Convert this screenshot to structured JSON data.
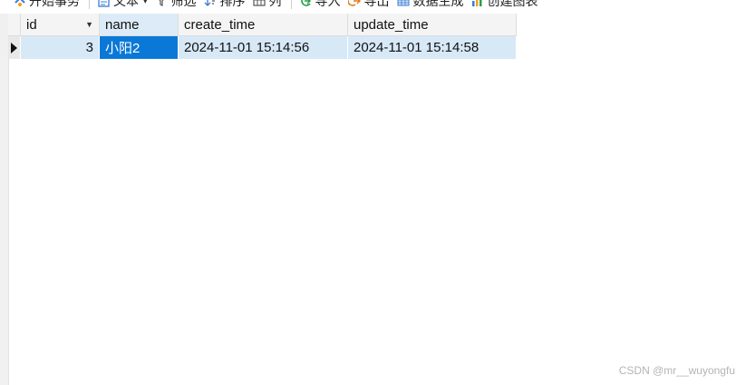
{
  "toolbar": {
    "items": [
      {
        "label": "开始事务",
        "icon": "transaction-icon"
      },
      {
        "label": "文本",
        "icon": "text-icon",
        "dropdown": true
      },
      {
        "label": "筛选",
        "icon": "filter-icon"
      },
      {
        "label": "排序",
        "icon": "sort-icon"
      },
      {
        "label": "列",
        "icon": "columns-icon"
      },
      {
        "label": "导入",
        "icon": "import-icon"
      },
      {
        "label": "导出",
        "icon": "export-icon"
      },
      {
        "label": "数据生成",
        "icon": "data-generate-icon"
      },
      {
        "label": "创建图表",
        "icon": "chart-icon"
      }
    ]
  },
  "table": {
    "columns": [
      "id",
      "name",
      "create_time",
      "update_time"
    ],
    "rows": [
      {
        "id": "3",
        "name": "小阳2",
        "create_time": "2024-11-01 15:14:56",
        "update_time": "2024-11-01 15:14:58"
      }
    ]
  },
  "watermark": "CSDN @mr__wuyongfu",
  "colors": {
    "selected_cell": "#0a78d7",
    "selected_row": "#d7e8f7",
    "header_selected": "#dcebf7"
  }
}
